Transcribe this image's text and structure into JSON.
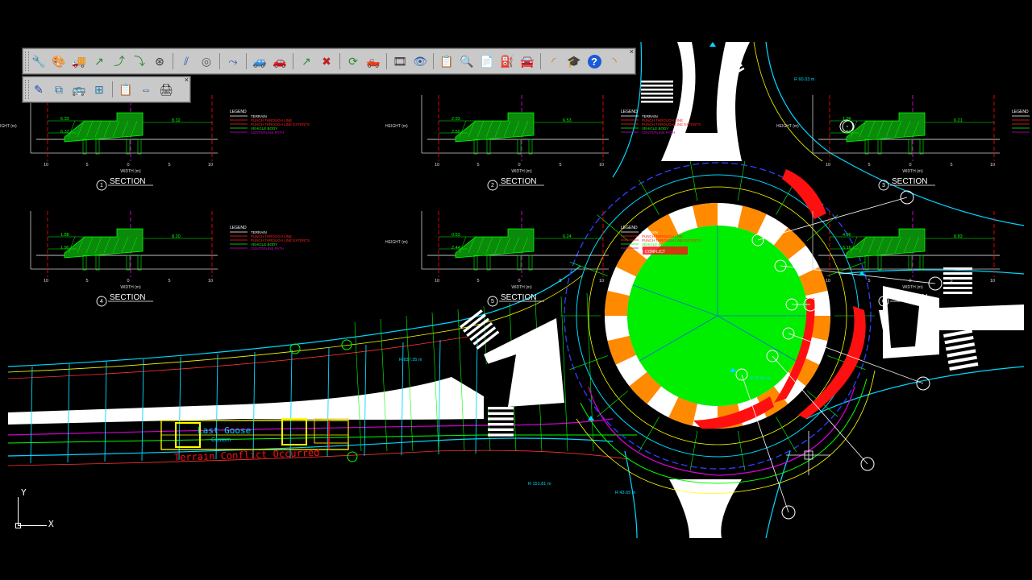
{
  "toolbar_main": {
    "close_label": "×",
    "buttons": [
      {
        "name": "wrench-icon",
        "glyph": "🔧",
        "color": "#c07a1a"
      },
      {
        "name": "palette-icon",
        "glyph": "🎨",
        "color": "#a34a2a"
      },
      {
        "name": "vehicle-icon",
        "glyph": "🚚",
        "color": "#2b5da8"
      },
      {
        "name": "path-arrow-icon",
        "glyph": "↗",
        "color": "#2f8a2f"
      },
      {
        "name": "path-curve-icon",
        "glyph": "⤴",
        "color": "#2f8a2f"
      },
      {
        "name": "path-drive-icon",
        "glyph": "⤵",
        "color": "#2f8a2f"
      },
      {
        "name": "steering-wheel-icon",
        "glyph": "⊛",
        "color": "#333333"
      },
      {
        "name": "sep",
        "glyph": ""
      },
      {
        "name": "swept-path-icon",
        "glyph": "⫽",
        "color": "#2b5da8"
      },
      {
        "name": "roundabout-icon",
        "glyph": "◎",
        "color": "#555555"
      },
      {
        "name": "sep",
        "glyph": ""
      },
      {
        "name": "curve-edit-icon",
        "glyph": "⤳",
        "color": "#2b5da8"
      },
      {
        "name": "sep",
        "glyph": ""
      },
      {
        "name": "add-vehicle-icon",
        "glyph": "🚙",
        "color": "#2b5da8"
      },
      {
        "name": "remove-vehicle-icon",
        "glyph": "🚗",
        "color": "#c02020"
      },
      {
        "name": "sep",
        "glyph": ""
      },
      {
        "name": "add-path-icon",
        "glyph": "↗",
        "color": "#2f8a2f"
      },
      {
        "name": "remove-path-icon",
        "glyph": "✖",
        "color": "#c02020"
      },
      {
        "name": "sep",
        "glyph": ""
      },
      {
        "name": "refresh-icon",
        "glyph": "⟳",
        "color": "#2f8a2f"
      },
      {
        "name": "vehicle-view-icon",
        "glyph": "🛻",
        "color": "#2b5da8"
      },
      {
        "name": "sep",
        "glyph": ""
      },
      {
        "name": "film-strip-icon",
        "glyph": "🎞",
        "color": "#333333"
      },
      {
        "name": "eye-icon",
        "glyph": "👁",
        "color": "#2b5da8"
      },
      {
        "name": "sep",
        "glyph": ""
      },
      {
        "name": "report-icon",
        "glyph": "📋",
        "color": "#333333"
      },
      {
        "name": "report-search-icon",
        "glyph": "🔍",
        "color": "#333333"
      },
      {
        "name": "document-icon",
        "glyph": "📄",
        "color": "#2b5da8"
      },
      {
        "name": "fuel-icon",
        "glyph": "⛽",
        "color": "#c07a1a"
      },
      {
        "name": "car-view-icon",
        "glyph": "🚘",
        "color": "#c07a1a"
      },
      {
        "name": "sep",
        "glyph": ""
      },
      {
        "name": "corner-icon",
        "glyph": "◜",
        "color": "#c07a1a"
      },
      {
        "name": "graduation-cap-icon",
        "glyph": "🎓",
        "color": "#1a3a8a"
      },
      {
        "name": "help-icon",
        "glyph": "?",
        "color": "#1a5ad8"
      },
      {
        "name": "corner-alt-icon",
        "glyph": "◝",
        "color": "#c07a1a"
      }
    ]
  },
  "toolbar_sub": {
    "close_label": "×",
    "buttons": [
      {
        "name": "pencil-tool-icon",
        "glyph": "✎",
        "color": "#1a4aa8"
      },
      {
        "name": "stack-layers-icon",
        "glyph": "⧉",
        "color": "#2b7aa8"
      },
      {
        "name": "vehicle-profile-icon",
        "glyph": "🚌",
        "color": "#555555"
      },
      {
        "name": "layer-grid-icon",
        "glyph": "⊞",
        "color": "#2b7aa8"
      },
      {
        "name": "sep",
        "glyph": ""
      },
      {
        "name": "clipboard-icon",
        "glyph": "📋",
        "color": "#c07a1a"
      },
      {
        "name": "dimension-icon",
        "glyph": "⇔",
        "color": "#2b5da8"
      },
      {
        "name": "printer-icon",
        "glyph": "🖨",
        "color": "#222222"
      }
    ]
  },
  "colors": {
    "background": "#000000",
    "island": "#00ee00",
    "apron_orange": "#ff8a00",
    "apron_white": "#ffffff",
    "conflict_red": "#ff1010",
    "cyan": "#00d8ff",
    "yellow": "#ffff00",
    "green": "#00ff00",
    "magenta": "#d000d0",
    "blue_dashed": "#3040ff"
  },
  "sections": [
    {
      "number": "1",
      "title": "SECTION",
      "legend": true,
      "dims": [
        "6.33",
        "6.32",
        "8.32"
      ],
      "height_label": "HEIGHT (m)",
      "xaxis_label": "WIDTH (m)",
      "ticks": [
        "10",
        "5",
        "0",
        "5",
        "10"
      ]
    },
    {
      "number": "2",
      "title": "SECTION",
      "legend": true,
      "dims": [
        "2.93",
        "2.50",
        "6.53"
      ],
      "height_label": "HEIGHT (m)",
      "xaxis_label": "WIDTH (m)",
      "ticks": [
        "10",
        "5",
        "0",
        "5",
        "10"
      ]
    },
    {
      "number": "3",
      "title": "SECTION",
      "legend": true,
      "dims": [
        "1.96",
        "1.50",
        "6.21"
      ],
      "height_label": "HEIGHT (m)",
      "xaxis_label": "WIDTH (m)",
      "ticks": [
        "10",
        "5",
        "0",
        "5",
        "10"
      ]
    },
    {
      "number": "4",
      "title": "SECTION",
      "legend": true,
      "dims": [
        "1.88",
        "1.90",
        "8.20"
      ],
      "height_label": "",
      "xaxis_label": "WIDTH (m)",
      "ticks": [
        "10",
        "5",
        "0",
        "5",
        "10"
      ]
    },
    {
      "number": "5",
      "title": "SECTION",
      "legend": true,
      "dims": [
        "0.53",
        "2.44",
        "6.24"
      ],
      "height_label": "HEIGHT (m)",
      "xaxis_label": "WIDTH (m)",
      "ticks": [
        "10",
        "5",
        "0",
        "5",
        "10"
      ]
    },
    {
      "number": "6",
      "title": "SECTION",
      "legend": false,
      "dims": [
        "4.06",
        "6.16",
        "8.83"
      ],
      "height_label": "",
      "xaxis_label": "WIDTH (m)",
      "ticks": [
        "10",
        "5",
        "0",
        "5",
        "10"
      ]
    }
  ],
  "legend": {
    "title": "LEGEND",
    "items": [
      {
        "label": "TERRAIN",
        "color": "#ffffff"
      },
      {
        "label": "PUNCH THROUGH LINE",
        "color": "#ff2020"
      },
      {
        "label": "PUNCH THROUGH LINE EXTENTS",
        "color": "#ff2020"
      },
      {
        "label": "VEHICLE BODY",
        "color": "#00ff00"
      },
      {
        "label": "CENTERLINE PATH",
        "color": "#d000d0"
      }
    ],
    "conflict_tag": "CONFLICT"
  },
  "plan": {
    "vehicle_name": "Last Goose",
    "vehicle_sub": "Custom",
    "conflict_message": "Terrain Conflict Occurred",
    "radii": [
      "R 837.35 m",
      "R 151.81 m",
      "R 43.65 m",
      "R 60.03 m",
      "R 25.00 m"
    ]
  },
  "ucs": {
    "x_label": "X",
    "y_label": "Y"
  }
}
